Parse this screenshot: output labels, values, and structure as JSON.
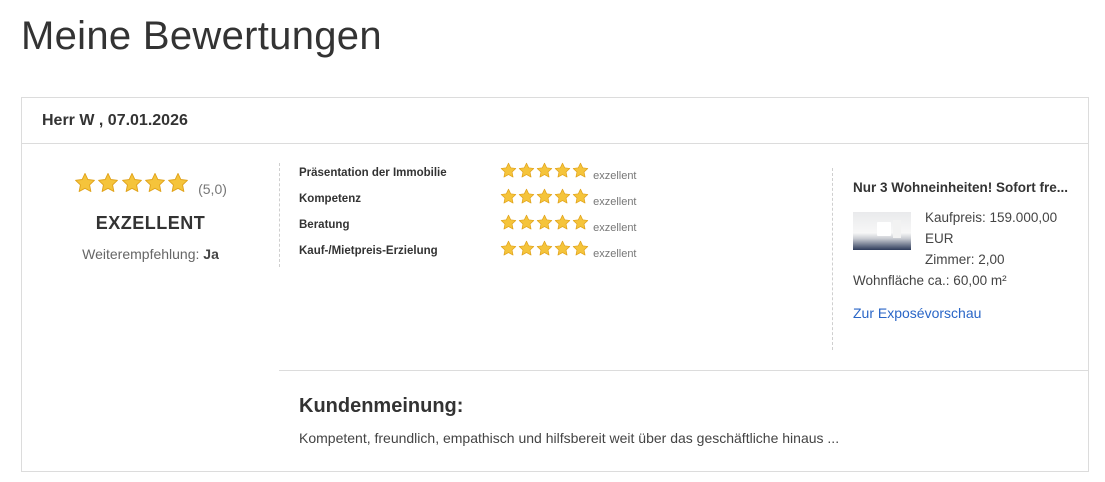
{
  "page": {
    "title": "Meine Bewertungen"
  },
  "review": {
    "header": "Herr W , 07.01.2026",
    "overall": {
      "stars": 5,
      "score_text": "(5,0)",
      "verdict": "EXZELLENT",
      "recommend_label": "Weiterempfehlung:",
      "recommend_value": "Ja"
    },
    "criteria": [
      {
        "label": "Präsentation der Immobilie",
        "stars": 5,
        "word": "exzellent"
      },
      {
        "label": "Kompetenz",
        "stars": 5,
        "word": "exzellent"
      },
      {
        "label": "Beratung",
        "stars": 5,
        "word": "exzellent"
      },
      {
        "label": "Kauf-/Mietpreis-Erzielung",
        "stars": 5,
        "word": "exzellent"
      }
    ],
    "listing": {
      "title": "Nur 3 Wohneinheiten! Sofort fre...",
      "price": "Kaufpreis: 159.000,00 EUR",
      "rooms": "Zimmer: 2,00",
      "area": "Wohnfläche ca.: 60,00 m²",
      "link": "Zur Exposévorschau"
    },
    "comment": {
      "title": "Kundenmeinung:",
      "text": "Kompetent, freundlich, empathisch und hilfsbereit weit über das geschäftliche hinaus ..."
    }
  },
  "colors": {
    "star": "#f5c43b",
    "star_edge": "#e0a21a",
    "link": "#2a66c7"
  }
}
